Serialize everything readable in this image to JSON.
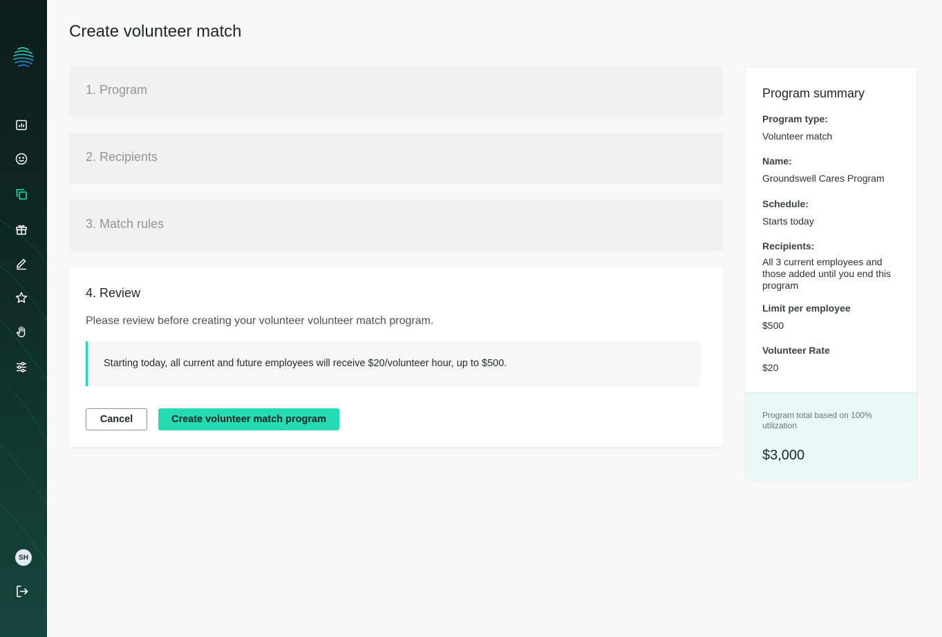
{
  "page": {
    "title": "Create volunteer match"
  },
  "sidebar": {
    "nav": [
      {
        "name": "reports",
        "icon": "bar-chart-icon"
      },
      {
        "name": "employees",
        "icon": "smiley-icon"
      },
      {
        "name": "programs",
        "icon": "copy-squares-icon",
        "active": true
      },
      {
        "name": "gifts",
        "icon": "gift-icon"
      },
      {
        "name": "edit",
        "icon": "pencil-icon"
      },
      {
        "name": "favorites",
        "icon": "star-icon"
      },
      {
        "name": "volunteer",
        "icon": "hand-icon"
      },
      {
        "name": "settings",
        "icon": "sliders-icon"
      }
    ],
    "avatar_initials": "SH",
    "accent_color": "#2fe0b6"
  },
  "steps": [
    {
      "label": "1. Program"
    },
    {
      "label": "2. Recipients"
    },
    {
      "label": "3. Match rules"
    }
  ],
  "review": {
    "title": "4. Review",
    "description": "Please review before creating your volunteer volunteer match program.",
    "callout": "Starting today, all current and future employees will receive $20/volunteer hour, up to $500.",
    "cancel_label": "Cancel",
    "create_label": "Create volunteer match program",
    "accent_color": "#25dbb4"
  },
  "summary": {
    "title": "Program summary",
    "items": [
      {
        "label": "Program type:",
        "value": "Volunteer match"
      },
      {
        "label": "Name:",
        "value": "Groundswell Cares Program"
      },
      {
        "label": "Schedule:",
        "value": "Starts today"
      },
      {
        "label": "Recipients:",
        "value": "All 3 current employees and those added until you end this program"
      },
      {
        "label": "Limit per employee",
        "value": "$500"
      },
      {
        "label": "Volunteer Rate",
        "value": "$20"
      }
    ],
    "total_label": "Program total based on 100% utilization",
    "total_value": "$3,000"
  }
}
